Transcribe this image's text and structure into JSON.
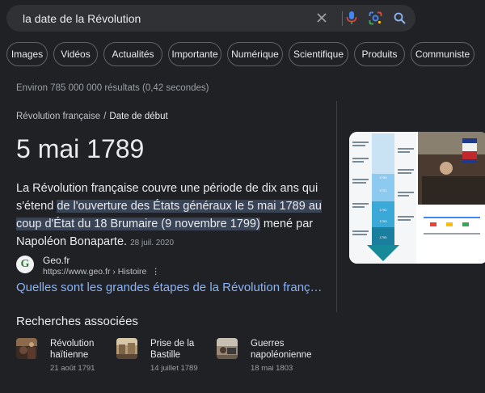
{
  "search": {
    "query": "la date de la Révolution",
    "icons": [
      "close-icon",
      "microphone-icon",
      "google-lens-icon",
      "search-icon"
    ]
  },
  "chips": [
    "Images",
    "Vidéos",
    "Actualités",
    "Importante",
    "Numérique",
    "Scientifique",
    "Produits",
    "Communiste"
  ],
  "results": {
    "count_text": "Environ 785 000 000 résultats (0,42 secondes)"
  },
  "featured": {
    "breadcrumb_parent": "Révolution française",
    "breadcrumb_separator": "/",
    "breadcrumb_current": "Date de début",
    "answer": "5 mai 1789",
    "desc_before": "La Révolution française couvre une période de dix ans qui s'étend ",
    "desc_highlight": "de l'ouverture des États généraux le 5 mai 1789 au coup d'État du 18 Brumaire (9 novembre 1799)",
    "desc_after": " mené par Napoléon Bonaparte.",
    "desc_date": "28 juil. 2020",
    "source_name": "Geo.fr",
    "source_url": "https://www.geo.fr › Histoire",
    "source_favicon_letter": "G",
    "link_text": "Quelles sont les grandes étapes de la Révolution franç…"
  },
  "related": {
    "title": "Recherches associées",
    "items": [
      {
        "label": "Révolution haïtienne",
        "date": "21 août 1791"
      },
      {
        "label": "Prise de la Bastille",
        "date": "14 juillet 1789"
      },
      {
        "label": "Guerres napoléonienne",
        "date": "18 mai 1803"
      }
    ]
  },
  "image_card": {
    "timeline_years": [
      "1789",
      "1791",
      "1792",
      "1793",
      "1795"
    ]
  },
  "colors": {
    "background": "#202124",
    "link": "#8ab4f8",
    "highlight": "#394457"
  }
}
